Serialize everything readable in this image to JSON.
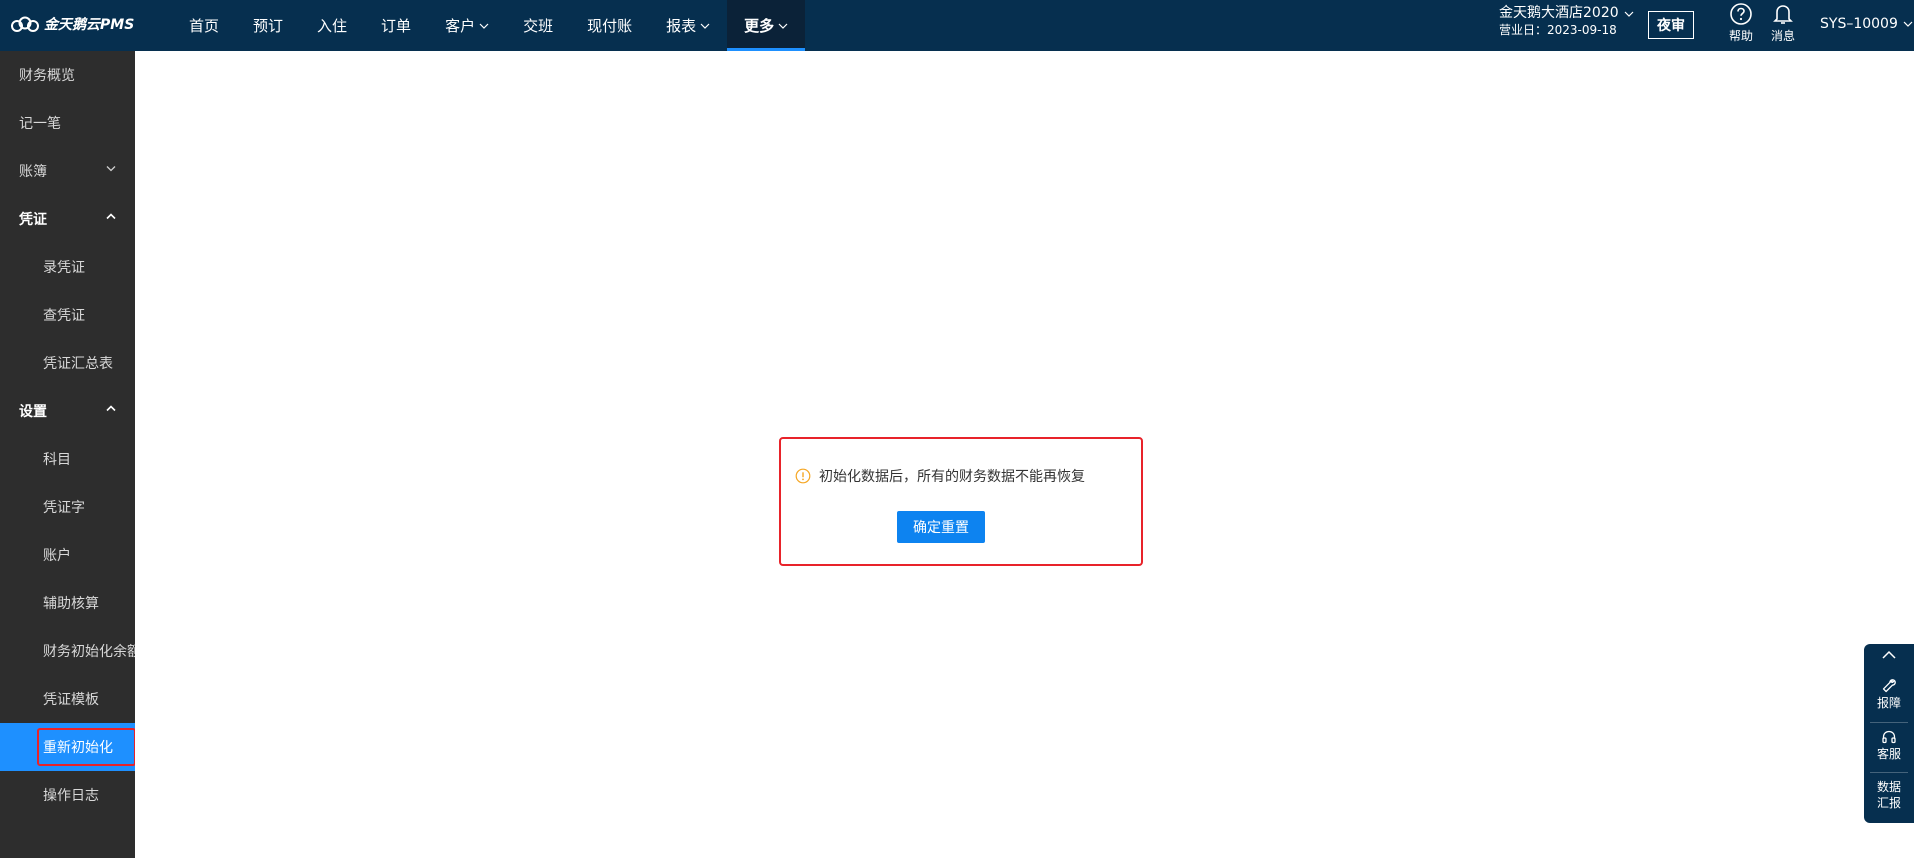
{
  "header": {
    "logo_text": "金天鹅云PMS",
    "nav": [
      {
        "label": "首页"
      },
      {
        "label": "预订"
      },
      {
        "label": "入住"
      },
      {
        "label": "订单"
      },
      {
        "label": "客户"
      },
      {
        "label": "交班"
      },
      {
        "label": "现付账"
      },
      {
        "label": "报表"
      },
      {
        "label": "更多"
      }
    ],
    "hotel_name": "金天鹅大酒店2020",
    "business_date": "营业日：2023-09-18",
    "night_audit_label": "夜审",
    "help_label": "帮助",
    "messages_label": "消息",
    "user_label": "SYS–10009"
  },
  "sidebar": {
    "items": [
      {
        "label": "财务概览"
      },
      {
        "label": "记一笔"
      },
      {
        "label": "账簿"
      },
      {
        "label": "凭证"
      },
      {
        "label": "录凭证"
      },
      {
        "label": "查凭证"
      },
      {
        "label": "凭证汇总表"
      },
      {
        "label": "设置"
      },
      {
        "label": "科目"
      },
      {
        "label": "凭证字"
      },
      {
        "label": "账户"
      },
      {
        "label": "辅助核算"
      },
      {
        "label": "财务初始化余额"
      },
      {
        "label": "凭证模板"
      },
      {
        "label": "重新初始化"
      },
      {
        "label": "操作日志"
      }
    ]
  },
  "main": {
    "warning_text": "初始化数据后，所有的财务数据不能再恢复",
    "confirm_label": "确定重置"
  },
  "float_bar": {
    "report_issue_label": "报障",
    "service_label": "客服",
    "data_report_line1": "数据",
    "data_report_line2": "汇报"
  },
  "colors": {
    "topbar": "#062f4f",
    "sidebar": "#2d2d2d",
    "accent": "#1e90ff",
    "highlight_border": "#e8232a",
    "warning": "#f5a623"
  }
}
